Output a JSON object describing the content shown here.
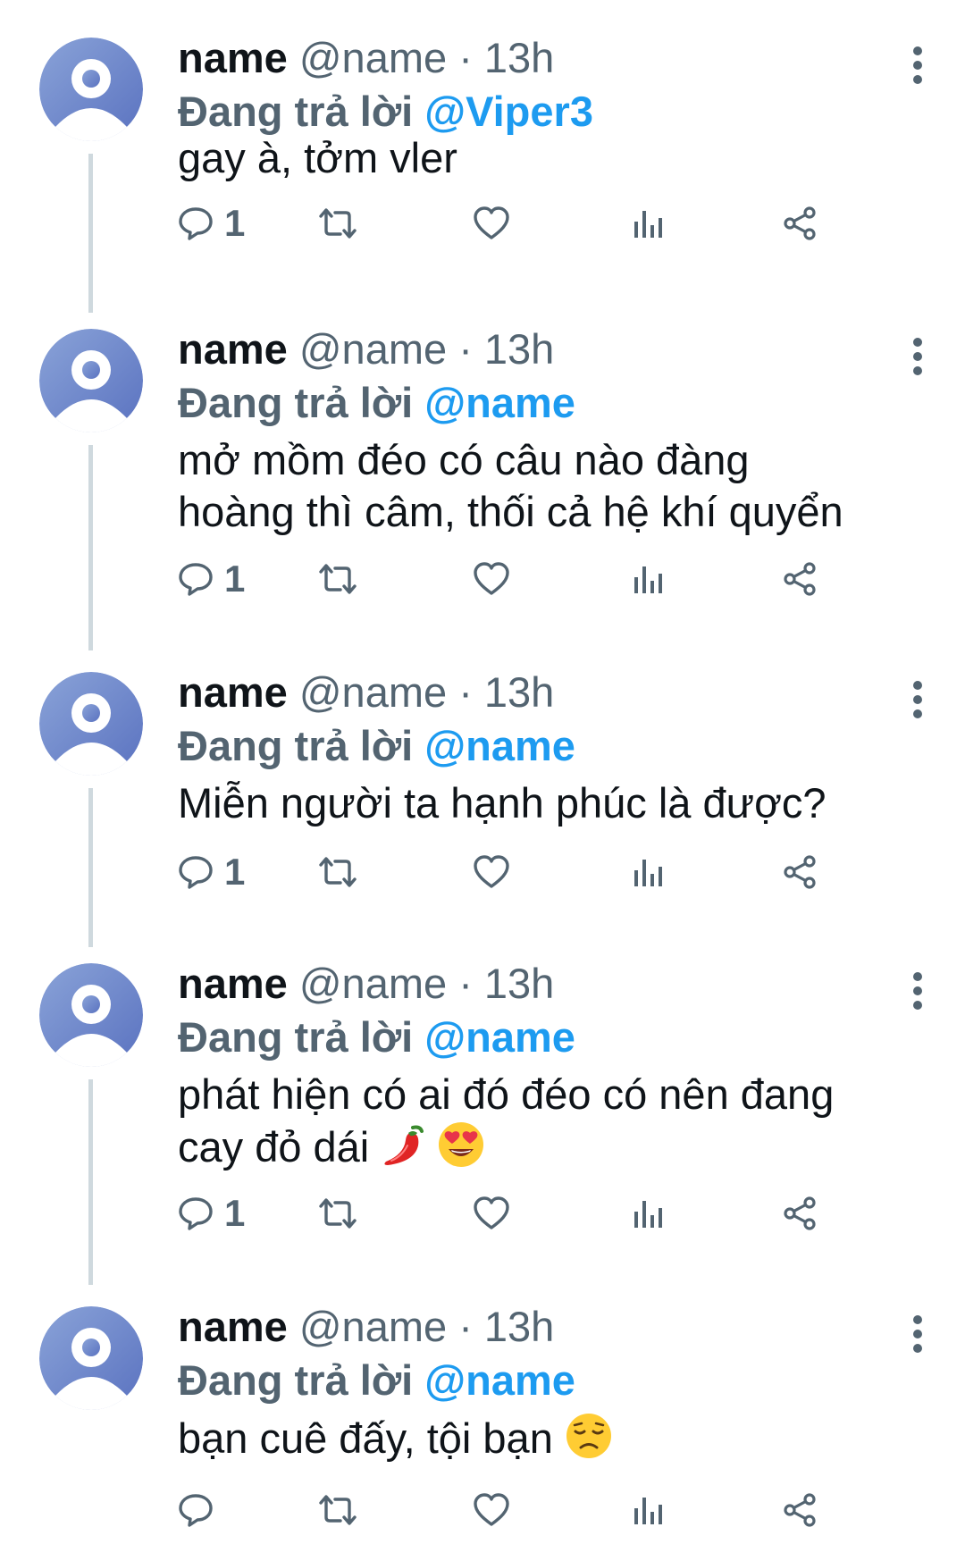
{
  "tweets": [
    {
      "display_name": "name",
      "handle": "@name",
      "separator": "·",
      "time": "13h",
      "reply_prefix": "Đang trả lời",
      "reply_to": "@Viper3",
      "text_lines": [
        "gay à, tởm vler"
      ],
      "reply_count": "1"
    },
    {
      "display_name": "name",
      "handle": "@name",
      "separator": "·",
      "time": "13h",
      "reply_prefix": "Đang trả lời",
      "reply_to": "@name",
      "text_lines": [
        "mở mồm đéo có câu nào đàng",
        "hoàng thì câm, thối cả hệ khí quyển"
      ],
      "reply_count": "1"
    },
    {
      "display_name": "name",
      "handle": "@name",
      "separator": "·",
      "time": "13h",
      "reply_prefix": "Đang trả lời",
      "reply_to": "@name",
      "text_lines": [
        "Miễn người ta hạnh phúc là được?"
      ],
      "reply_count": "1"
    },
    {
      "display_name": "name",
      "handle": "@name",
      "separator": "·",
      "time": "13h",
      "reply_prefix": "Đang trả lời",
      "reply_to": "@name",
      "text_lines": [
        "phát hiện có ai đó đéo có nên đang",
        "cay đỏ dái"
      ],
      "emojis": [
        "hot-pepper-emoji",
        "heart-eyes-emoji"
      ],
      "reply_count": "1"
    },
    {
      "display_name": "name",
      "handle": "@name",
      "separator": "·",
      "time": "13h",
      "reply_prefix": "Đang trả lời",
      "reply_to": "@name",
      "text_lines": [
        "bạn cuê đấy, tội bạn"
      ],
      "emojis": [
        "disappointed-face-emoji"
      ],
      "reply_count": ""
    }
  ],
  "icons": {
    "reply": "speech-bubble-icon",
    "retweet": "retweet-icon",
    "like": "heart-icon",
    "views": "bar-chart-icon",
    "share": "share-icon",
    "more": "vertical-dots-icon"
  },
  "colors": {
    "mention": "#1d9bf0",
    "secondary_text": "#536471",
    "primary_text": "#0f1419",
    "thread_line": "#cfd9de",
    "avatar_bg": "#6f88cc"
  }
}
